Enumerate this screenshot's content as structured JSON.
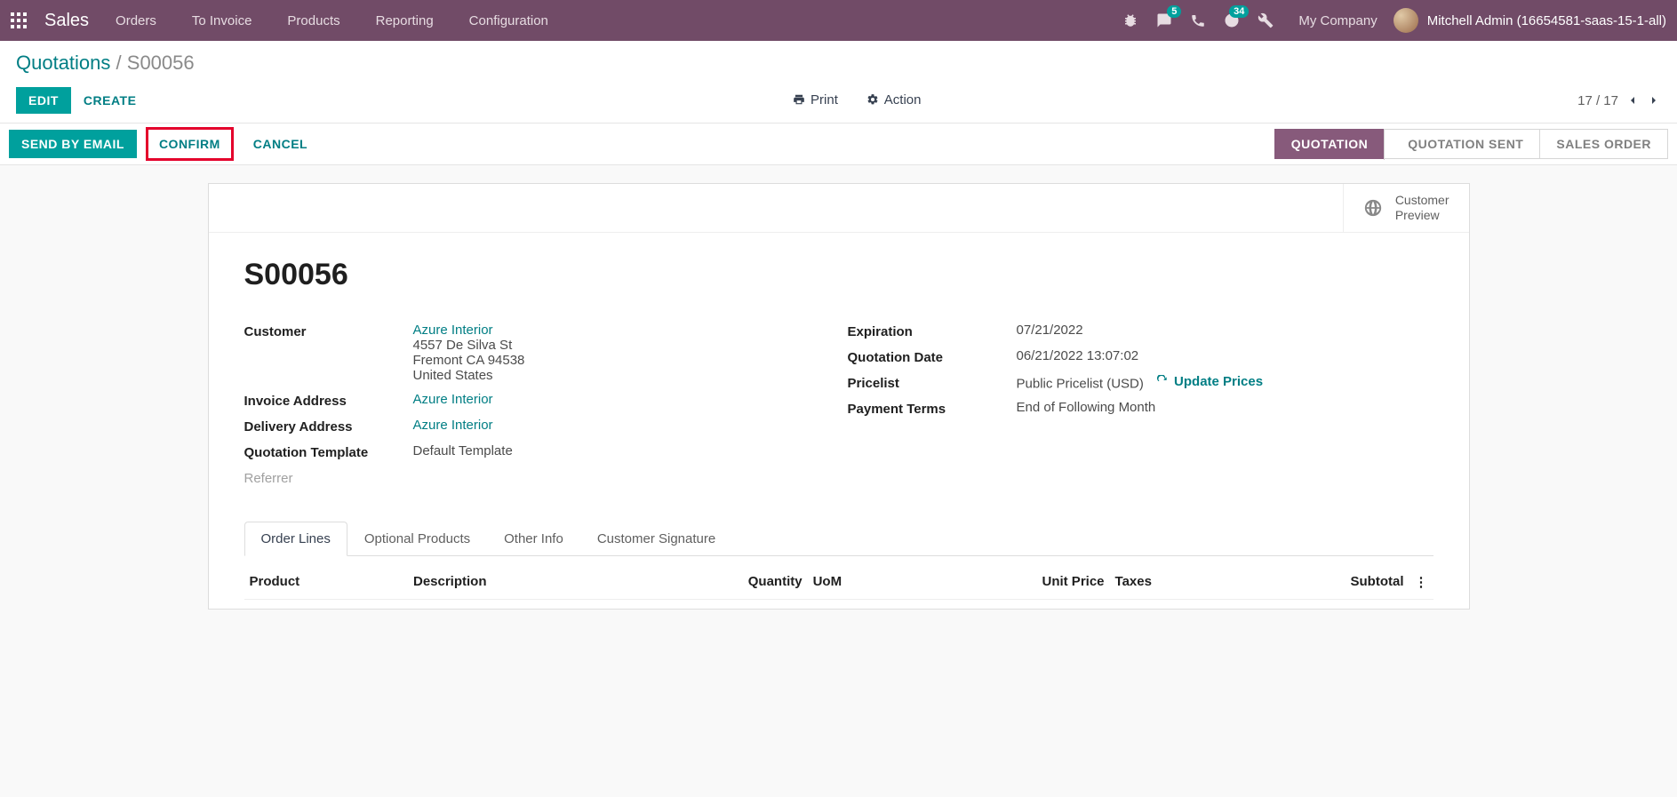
{
  "nav": {
    "brand": "Sales",
    "items": [
      "Orders",
      "To Invoice",
      "Products",
      "Reporting",
      "Configuration"
    ],
    "badge_discuss": "5",
    "badge_activities": "34",
    "company": "My Company",
    "user": "Mitchell Admin (16654581-saas-15-1-all)"
  },
  "breadcrumb": {
    "parent": "Quotations",
    "current": "S00056"
  },
  "controls": {
    "edit": "EDIT",
    "create": "CREATE",
    "print": "Print",
    "action": "Action",
    "pager": "17 / 17"
  },
  "statusbar": {
    "send_email": "SEND BY EMAIL",
    "confirm": "CONFIRM",
    "cancel": "CANCEL",
    "stages": [
      "QUOTATION",
      "QUOTATION SENT",
      "SALES ORDER"
    ],
    "active_stage": 0
  },
  "statbutton": {
    "line1": "Customer",
    "line2": "Preview"
  },
  "record": {
    "name": "S00056",
    "left": {
      "customer_label": "Customer",
      "customer_link": "Azure Interior",
      "addr1": "4557 De Silva St",
      "addr2": "Fremont CA 94538",
      "addr3": "United States",
      "invoice_label": "Invoice Address",
      "invoice_link": "Azure Interior",
      "delivery_label": "Delivery Address",
      "delivery_link": "Azure Interior",
      "template_label": "Quotation Template",
      "template_value": "Default Template",
      "referrer_label": "Referrer"
    },
    "right": {
      "expiration_label": "Expiration",
      "expiration_value": "07/21/2022",
      "date_label": "Quotation Date",
      "date_value": "06/21/2022 13:07:02",
      "pricelist_label": "Pricelist",
      "pricelist_value": "Public Pricelist (USD)",
      "update_prices": "Update Prices",
      "terms_label": "Payment Terms",
      "terms_value": "End of Following Month"
    }
  },
  "tabs": [
    "Order Lines",
    "Optional Products",
    "Other Info",
    "Customer Signature"
  ],
  "columns": {
    "product": "Product",
    "description": "Description",
    "quantity": "Quantity",
    "uom": "UoM",
    "unit_price": "Unit Price",
    "taxes": "Taxes",
    "subtotal": "Subtotal"
  }
}
